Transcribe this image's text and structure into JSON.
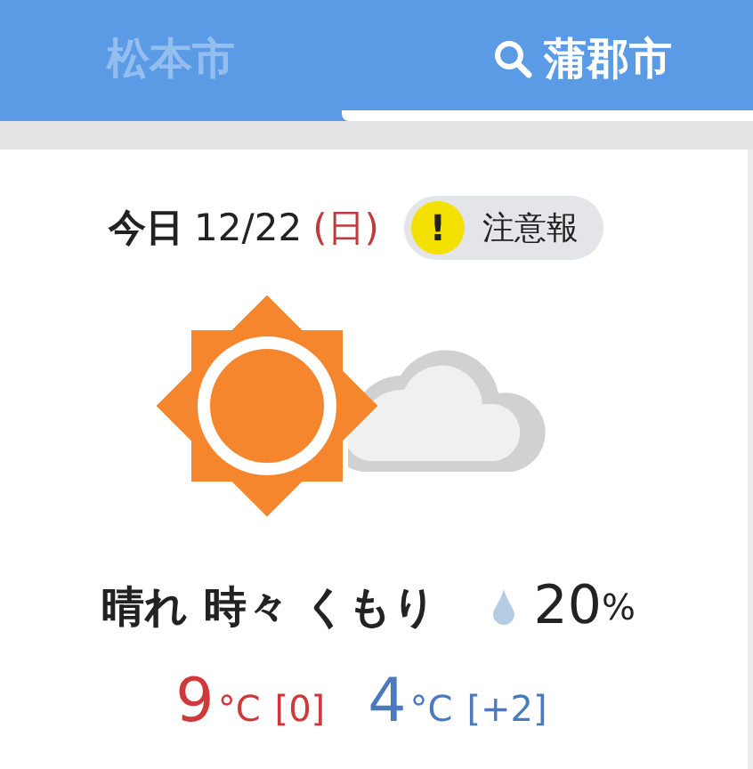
{
  "tabs": [
    {
      "label": "松本市",
      "selected": false
    },
    {
      "label": "蒲郡市",
      "selected": true
    }
  ],
  "date": {
    "day_label": "今日",
    "date": "12/22",
    "weekday": "(日)"
  },
  "alert": {
    "icon": "!",
    "label": "注意報"
  },
  "forecast": {
    "weather": "晴れ 時々 くもり",
    "precipitation": {
      "value": "20",
      "unit": "%"
    }
  },
  "temperatures": [
    {
      "kind": "high",
      "value": "9",
      "unit": "°C",
      "difference": "[0]"
    },
    {
      "kind": "low",
      "value": "4",
      "unit": "°C",
      "difference": "[+2]"
    }
  ]
}
